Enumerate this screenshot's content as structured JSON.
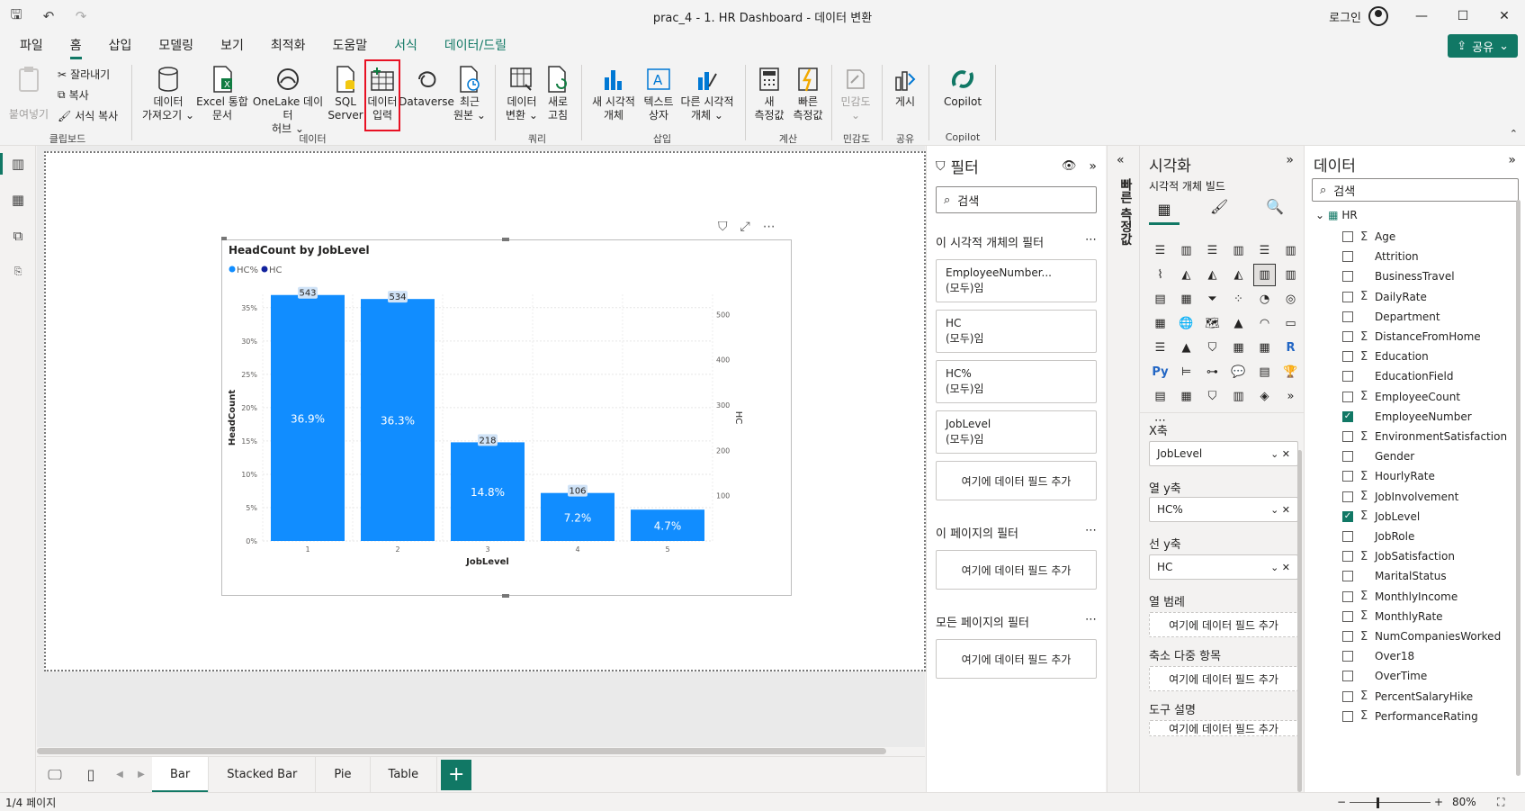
{
  "title": "prac_4 - 1. HR Dashboard - 데이터 변환",
  "login": "로그인",
  "menu": [
    "파일",
    "홈",
    "삽입",
    "모델링",
    "보기",
    "최적화",
    "도움말",
    "서식",
    "데이터/드릴"
  ],
  "share": "공유",
  "ribbon": {
    "paste": "붙여넣기",
    "cut": "잘라내기",
    "copy": "복사",
    "format_copy": "서식 복사",
    "clipboard": "클립보드",
    "get_data": [
      "데이터",
      "가져오기 ⌄"
    ],
    "excel": [
      "Excel 통합",
      "문서"
    ],
    "onelake": [
      "OneLake 데이터",
      "허브 ⌄"
    ],
    "sql": [
      "SQL",
      "Server"
    ],
    "enter_data": [
      "데이터",
      "입력"
    ],
    "dataverse": "Dataverse",
    "recent": [
      "최근",
      "원본 ⌄"
    ],
    "data_group": "데이터",
    "transform": [
      "데이터",
      "변환 ⌄"
    ],
    "refresh": [
      "새로",
      "고침"
    ],
    "query_group": "쿼리",
    "new_visual": [
      "새 시각적",
      "개체"
    ],
    "textbox": [
      "텍스트",
      "상자"
    ],
    "more_visuals": [
      "다른 시각적",
      "개체 ⌄"
    ],
    "insert_group": "삽입",
    "new_measure": [
      "새",
      "측정값"
    ],
    "quick_measure": [
      "빠른",
      "측정값"
    ],
    "calc_group": "계산",
    "sensitivity": [
      "민감도",
      "⌄"
    ],
    "sensitivity_group": "민감도",
    "publish": "게시",
    "share_group": "공유",
    "copilot": "Copilot",
    "copilot_group": "Copilot"
  },
  "tabs": [
    "Bar",
    "Stacked Bar",
    "Pie",
    "Table"
  ],
  "status": "1/4 페이지",
  "zoom": "80%",
  "chart_data": {
    "type": "bar",
    "title": "HeadCount by JobLevel",
    "legend": [
      "HC%",
      "HC"
    ],
    "xlabel": "JobLevel",
    "ylabel": "HeadCount",
    "y2label": "HC",
    "categories": [
      "1",
      "2",
      "3",
      "4",
      "5"
    ],
    "series": [
      {
        "name": "HC%",
        "values": [
          36.9,
          36.3,
          14.8,
          7.2,
          4.7
        ],
        "labels": [
          "36.9%",
          "36.3%",
          "14.8%",
          "7.2%",
          "4.7%"
        ]
      },
      {
        "name": "HC",
        "values": [
          543,
          534,
          218,
          106,
          69
        ],
        "labels": [
          "543",
          "534",
          "218",
          "106",
          ""
        ]
      }
    ],
    "ylim": [
      0,
      37
    ],
    "yticks": [
      "0%",
      "5%",
      "10%",
      "15%",
      "20%",
      "25%",
      "30%",
      "35%"
    ],
    "y2ticks": [
      "100",
      "200",
      "300",
      "400",
      "500"
    ],
    "color": "#118dff"
  },
  "filters": {
    "title": "필터",
    "search": "검색",
    "visual_section": "이 시각적 개체의 필터",
    "cards": [
      {
        "name": "EmployeeNumber...",
        "state": "(모두)임"
      },
      {
        "name": "HC",
        "state": "(모두)임"
      },
      {
        "name": "HC%",
        "state": "(모두)임"
      },
      {
        "name": "JobLevel",
        "state": "(모두)임"
      }
    ],
    "add": "여기에 데이터 필드 추가",
    "page_section": "이 페이지의 필터",
    "all_section": "모든 페이지의 필터"
  },
  "quick": "빠른 측정값",
  "viz": {
    "title": "시각화",
    "build": "시각적 개체 빌드",
    "x_label": "X축",
    "x_value": "JobLevel",
    "col_y_label": "열 y축",
    "col_y_value": "HC%",
    "line_y_label": "선 y축",
    "line_y_value": "HC",
    "legend_label": "열 범례",
    "small_multi": "축소 다중 항목",
    "tooltip": "도구 설명",
    "add": "여기에 데이터 필드 추가"
  },
  "data": {
    "title": "데이터",
    "search": "검색",
    "table": "HR",
    "fields": [
      {
        "name": "Age",
        "sigma": true,
        "checked": false
      },
      {
        "name": "Attrition",
        "sigma": false,
        "checked": false
      },
      {
        "name": "BusinessTravel",
        "sigma": false,
        "checked": false
      },
      {
        "name": "DailyRate",
        "sigma": true,
        "checked": false
      },
      {
        "name": "Department",
        "sigma": false,
        "checked": false
      },
      {
        "name": "DistanceFromHome",
        "sigma": true,
        "checked": false
      },
      {
        "name": "Education",
        "sigma": true,
        "checked": false
      },
      {
        "name": "EducationField",
        "sigma": false,
        "checked": false
      },
      {
        "name": "EmployeeCount",
        "sigma": true,
        "checked": false
      },
      {
        "name": "EmployeeNumber",
        "sigma": false,
        "checked": true
      },
      {
        "name": "EnvironmentSatisfaction",
        "sigma": true,
        "checked": false
      },
      {
        "name": "Gender",
        "sigma": false,
        "checked": false
      },
      {
        "name": "HourlyRate",
        "sigma": true,
        "checked": false
      },
      {
        "name": "JobInvolvement",
        "sigma": true,
        "checked": false
      },
      {
        "name": "JobLevel",
        "sigma": true,
        "checked": true
      },
      {
        "name": "JobRole",
        "sigma": false,
        "checked": false
      },
      {
        "name": "JobSatisfaction",
        "sigma": true,
        "checked": false
      },
      {
        "name": "MaritalStatus",
        "sigma": false,
        "checked": false
      },
      {
        "name": "MonthlyIncome",
        "sigma": true,
        "checked": false
      },
      {
        "name": "MonthlyRate",
        "sigma": true,
        "checked": false
      },
      {
        "name": "NumCompaniesWorked",
        "sigma": true,
        "checked": false
      },
      {
        "name": "Over18",
        "sigma": false,
        "checked": false
      },
      {
        "name": "OverTime",
        "sigma": false,
        "checked": false
      },
      {
        "name": "PercentSalaryHike",
        "sigma": true,
        "checked": false
      },
      {
        "name": "PerformanceRating",
        "sigma": true,
        "checked": false
      }
    ]
  }
}
